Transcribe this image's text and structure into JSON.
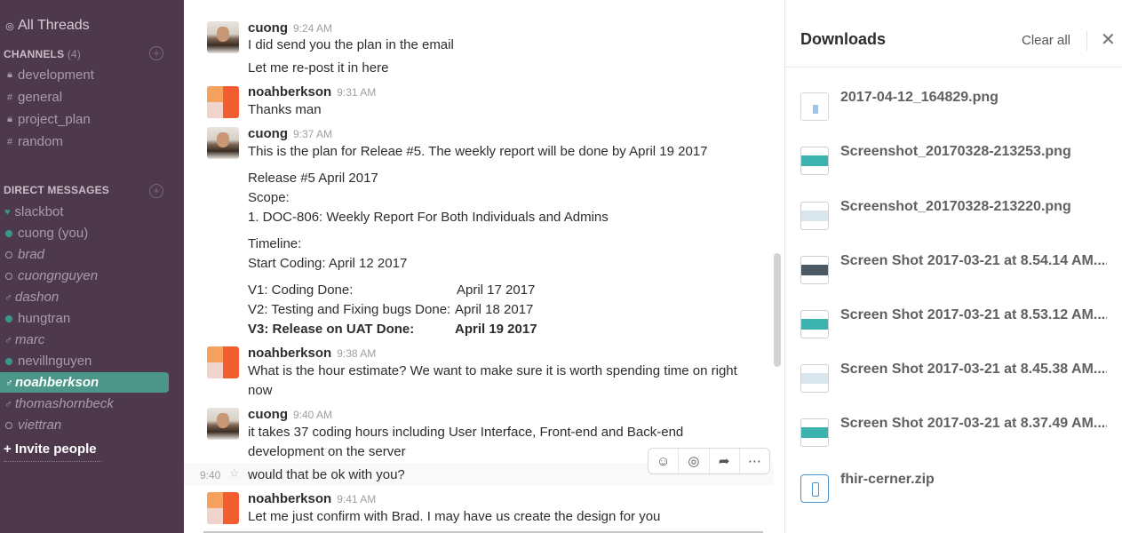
{
  "sidebar": {
    "all_threads": "All Threads",
    "channels_header": "CHANNELS",
    "channels_count": "(4)",
    "channels": [
      {
        "name": "development",
        "icon": "lock-icon"
      },
      {
        "name": "general",
        "icon": "hash-icon"
      },
      {
        "name": "project_plan",
        "icon": "lock-icon"
      },
      {
        "name": "random",
        "icon": "hash-icon"
      }
    ],
    "dm_header": "DIRECT MESSAGES",
    "dms": [
      {
        "name": "slackbot",
        "status": "heart"
      },
      {
        "name": "cuong (you)",
        "status": "online"
      },
      {
        "name": "brad",
        "status": "away"
      },
      {
        "name": "cuongnguyen",
        "status": "away"
      },
      {
        "name": "dashon",
        "status": "gender"
      },
      {
        "name": "hungtran",
        "status": "online"
      },
      {
        "name": "marc",
        "status": "gender"
      },
      {
        "name": "nevillnguyen",
        "status": "online"
      },
      {
        "name": "noahberkson",
        "status": "gender",
        "selected": true
      },
      {
        "name": "thomashornbeck",
        "status": "gender"
      },
      {
        "name": "viettran",
        "status": "away"
      }
    ],
    "invite": "+ Invite people"
  },
  "messages": [
    {
      "author": "cuong",
      "time": "9:24 AM",
      "lines": [
        "I did send you the plan in the email",
        "Let me re-post it in here"
      ]
    },
    {
      "author": "noahberkson",
      "time": "9:31 AM",
      "lines": [
        "Thanks man"
      ]
    },
    {
      "author": "cuong",
      "time": "9:37 AM",
      "lines": [
        "This is the plan for Releae #5. The weekly report will be done by April 19 2017",
        "Release #5 April 2017",
        "Scope:",
        "1. DOC-806: Weekly Report For Both Individuals and Admins",
        "Timeline:",
        "Start Coding: April 12 2017"
      ]
    },
    {
      "author": "noahberkson",
      "time": "9:38 AM",
      "lines": [
        "What is the hour estimate? We want to make sure it is worth spending time on right",
        "now"
      ]
    },
    {
      "author": "cuong",
      "time": "9:40 AM",
      "lines": [
        "it takes 37 coding hours including User Interface, Front-end and Back-end",
        "development on the server"
      ]
    },
    {
      "author": "noahberkson",
      "time": "9:41 AM",
      "lines": [
        "Let me just confirm with Brad. I may have us create the design for you"
      ]
    }
  ],
  "timeline_rows": [
    {
      "label": "V1: Coding Done:",
      "date": "April 17 2017"
    },
    {
      "label": "V2: Testing and Fixing bugs Done:",
      "date": "April 18 2017"
    },
    {
      "label": "V3: Release on UAT Done:",
      "date": "April 19 2017"
    }
  ],
  "hover_message": {
    "time": "9:40",
    "text": "would that be ok with you?"
  },
  "downloads": {
    "title": "Downloads",
    "clear_all": "Clear all",
    "files": [
      "2017-04-12_164829.png",
      "Screenshot_20170328-213253.png",
      "Screenshot_20170328-213220.png",
      "Screen Shot 2017-03-21 at 8.54.14 AM....",
      "Screen Shot 2017-03-21 at 8.53.12 AM....",
      "Screen Shot 2017-03-21 at 8.45.38 AM....",
      "Screen Shot 2017-03-21 at 8.37.49 AM....",
      "fhir-cerner.zip"
    ]
  },
  "colors": {
    "sidebar_bg": "#4d394b",
    "selected_bg": "#4c9689",
    "presence_green": "#38978d"
  }
}
